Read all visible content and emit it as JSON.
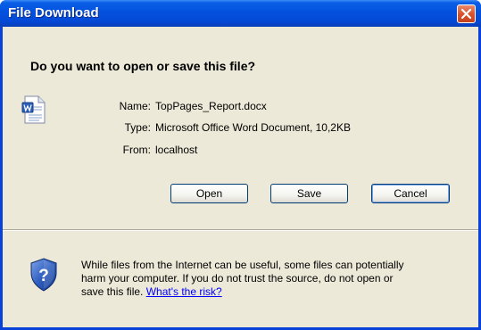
{
  "window": {
    "title": "File Download",
    "close_icon": "close-x-icon"
  },
  "dialog": {
    "question": "Do you want to open or save this file?",
    "file_icon": "word-document-icon",
    "name_label": "Name:",
    "name_value": "TopPages_Report.docx",
    "type_label": "Type:",
    "type_value": "Microsoft Office Word Document, 10,2KB",
    "from_label": "From:",
    "from_value": "localhost"
  },
  "buttons": {
    "open_label": "Open",
    "save_label": "Save",
    "cancel_label": "Cancel"
  },
  "warning": {
    "icon": "shield-question-icon",
    "line1": "While files from the Internet can be useful, some files can potentially",
    "line2": "harm your computer. If you do not trust the source, do not open or",
    "line3_text": "save this file.",
    "risk_link": "What's the risk?"
  },
  "colors": {
    "titlebar": "#0451de",
    "dialog_bg": "#ece9d8",
    "close_button": "#d8542f",
    "link": "#0000ff"
  }
}
